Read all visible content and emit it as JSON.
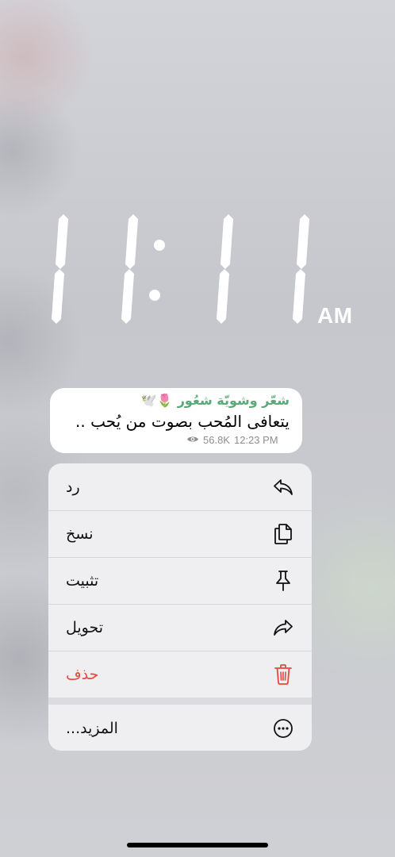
{
  "clock": {
    "digits": [
      "1",
      "1",
      "1",
      "1"
    ],
    "separator": ":",
    "ampm": "AM"
  },
  "message": {
    "sender": "شعّر وشويّة شعُور",
    "sender_emojis": "🌷🕊️",
    "text": "يتعافى المُحب بصوت من يُحب ..",
    "views": "56.8K",
    "time": "12:23 PM"
  },
  "menu": {
    "items": [
      {
        "label": "رد",
        "icon": "reply-icon",
        "danger": false
      },
      {
        "label": "نسخ",
        "icon": "copy-icon",
        "danger": false
      },
      {
        "label": "تثبيت",
        "icon": "pin-icon",
        "danger": false
      },
      {
        "label": "تحويل",
        "icon": "forward-icon",
        "danger": false
      },
      {
        "label": "حذف",
        "icon": "trash-icon",
        "danger": true
      },
      {
        "label": "المزيد...",
        "icon": "more-icon",
        "danger": false
      }
    ]
  },
  "colors": {
    "accent_green": "#5aa978",
    "danger_red": "#e8483b",
    "meta_gray": "#8e8e93"
  }
}
